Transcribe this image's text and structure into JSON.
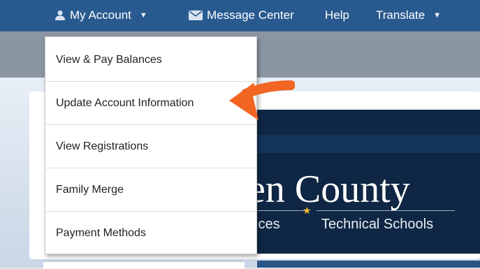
{
  "topnav": {
    "account_label": "My Account",
    "message_label": "Message Center",
    "help_label": "Help",
    "translate_label": "Translate"
  },
  "dropdown": {
    "items": [
      {
        "label": "View & Pay Balances"
      },
      {
        "label": "Update Account Information"
      },
      {
        "label": "View Registrations"
      },
      {
        "label": "Family Merge"
      },
      {
        "label": "Payment Methods"
      }
    ]
  },
  "banner": {
    "title": "en County",
    "sub1": "vices",
    "sub2": "Technical Schools"
  },
  "colors": {
    "nav_bg": "#285a8f",
    "arrow": "#f26522",
    "banner_bg": "#0f2744"
  }
}
